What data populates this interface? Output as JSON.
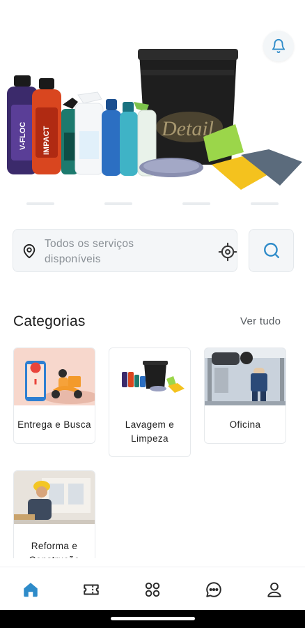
{
  "header": {
    "notification_icon": "bell-icon",
    "hero_bucket_text": "Detail"
  },
  "search": {
    "placeholder": "Todos os serviços disponíveis",
    "pin_icon": "location-pin-icon",
    "locate_icon": "crosshair-icon",
    "search_icon": "search-icon"
  },
  "categories": {
    "title": "Categorias",
    "see_all": "Ver tudo",
    "items": [
      {
        "label": "Entrega e Busca"
      },
      {
        "label": "Lavagem e Limpeza"
      },
      {
        "label": "Oficina"
      },
      {
        "label": "Reforma e Construção"
      }
    ]
  },
  "bottom_nav": {
    "items": [
      {
        "icon": "home-icon",
        "active": true
      },
      {
        "icon": "ticket-icon",
        "active": false
      },
      {
        "icon": "apps-icon",
        "active": false
      },
      {
        "icon": "chat-icon",
        "active": false
      },
      {
        "icon": "profile-icon",
        "active": false
      }
    ]
  },
  "colors": {
    "accent": "#2e8bc9",
    "icon_dark": "#2a2a2a",
    "icon_grey": "#4a5056"
  }
}
